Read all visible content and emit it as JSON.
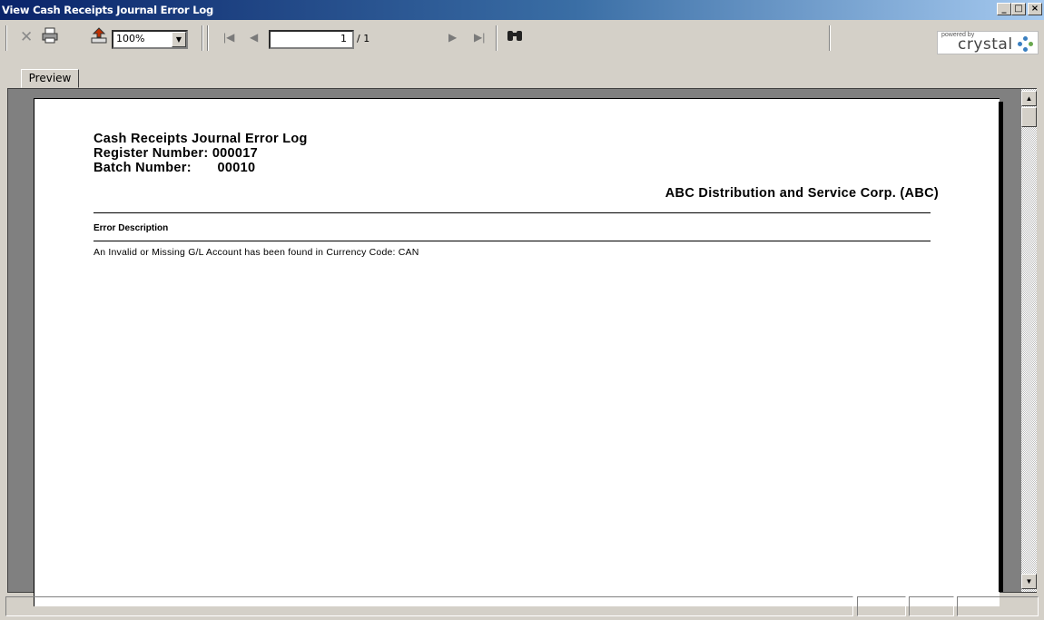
{
  "window": {
    "title": "View Cash Receipts Journal Error Log",
    "minimize_label": "_",
    "maximize_label": "□",
    "close_label": "×"
  },
  "toolbar": {
    "zoom_value": "100%",
    "page_current": "1",
    "page_total": "/ 1",
    "logo_powered_by": "powered by",
    "logo_text": "crystal"
  },
  "tabs": [
    {
      "label": "Preview"
    }
  ],
  "report": {
    "title": "Cash Receipts Journal Error Log",
    "register_label": "Register Number:",
    "register_value": "000017",
    "batch_label": "Batch Number:",
    "batch_value": "00010",
    "company": "ABC Distribution and Service Corp. (ABC)",
    "column_header": "Error Description",
    "rows": [
      "An Invalid or Missing G/L Account has been found in Currency Code: CAN"
    ]
  },
  "colors": {
    "titlebar_start": "#0a246a",
    "titlebar_end": "#a6caf0",
    "chrome": "#d4d0c8"
  }
}
